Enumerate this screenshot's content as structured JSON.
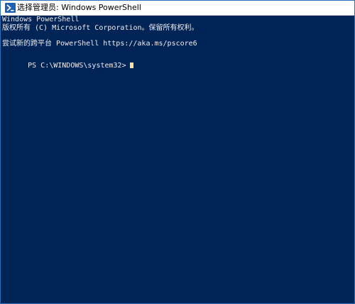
{
  "window": {
    "title": "选择管理员: Windows PowerShell",
    "icon": "powershell-icon"
  },
  "console": {
    "lines": [
      "Windows PowerShell",
      "版权所有 (C) Microsoft Corporation。保留所有权利。",
      "尝试新的跨平台 PowerShell https://aka.ms/pscore6"
    ],
    "prompt": "PS C:\\WINDOWS\\system32>"
  },
  "colors": {
    "background": "#012456",
    "text": "#eeedf0",
    "cursor": "#fde09a"
  }
}
